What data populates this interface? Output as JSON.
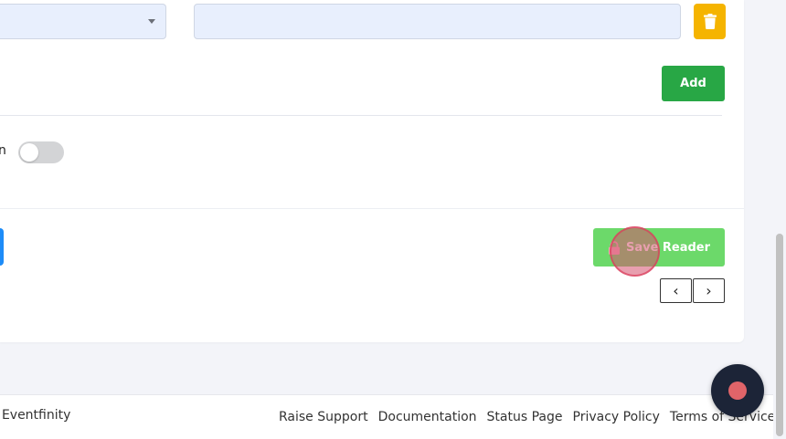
{
  "form": {
    "text_value": "",
    "add_label": "Add",
    "toggle_label_fragment": "n",
    "toggle_on": false,
    "save_label": "Save Reader"
  },
  "pager": {
    "prev_symbol": "‹",
    "next_symbol": "›"
  },
  "footer": {
    "copyright_fragment": "t Eventfinity",
    "links": [
      "Raise Support",
      "Documentation",
      "Status Page",
      "Privacy Policy",
      "Terms of Service"
    ]
  },
  "icons": {
    "trash": "trash-icon",
    "lock": "lock-icon",
    "caret": "caret-down-icon",
    "record": "record-icon"
  },
  "colors": {
    "add_button": "#28a745",
    "save_button": "#6cd96a",
    "delete_button": "#f5b400",
    "input_bg": "#e8effd",
    "record_button": "#1c2437"
  }
}
